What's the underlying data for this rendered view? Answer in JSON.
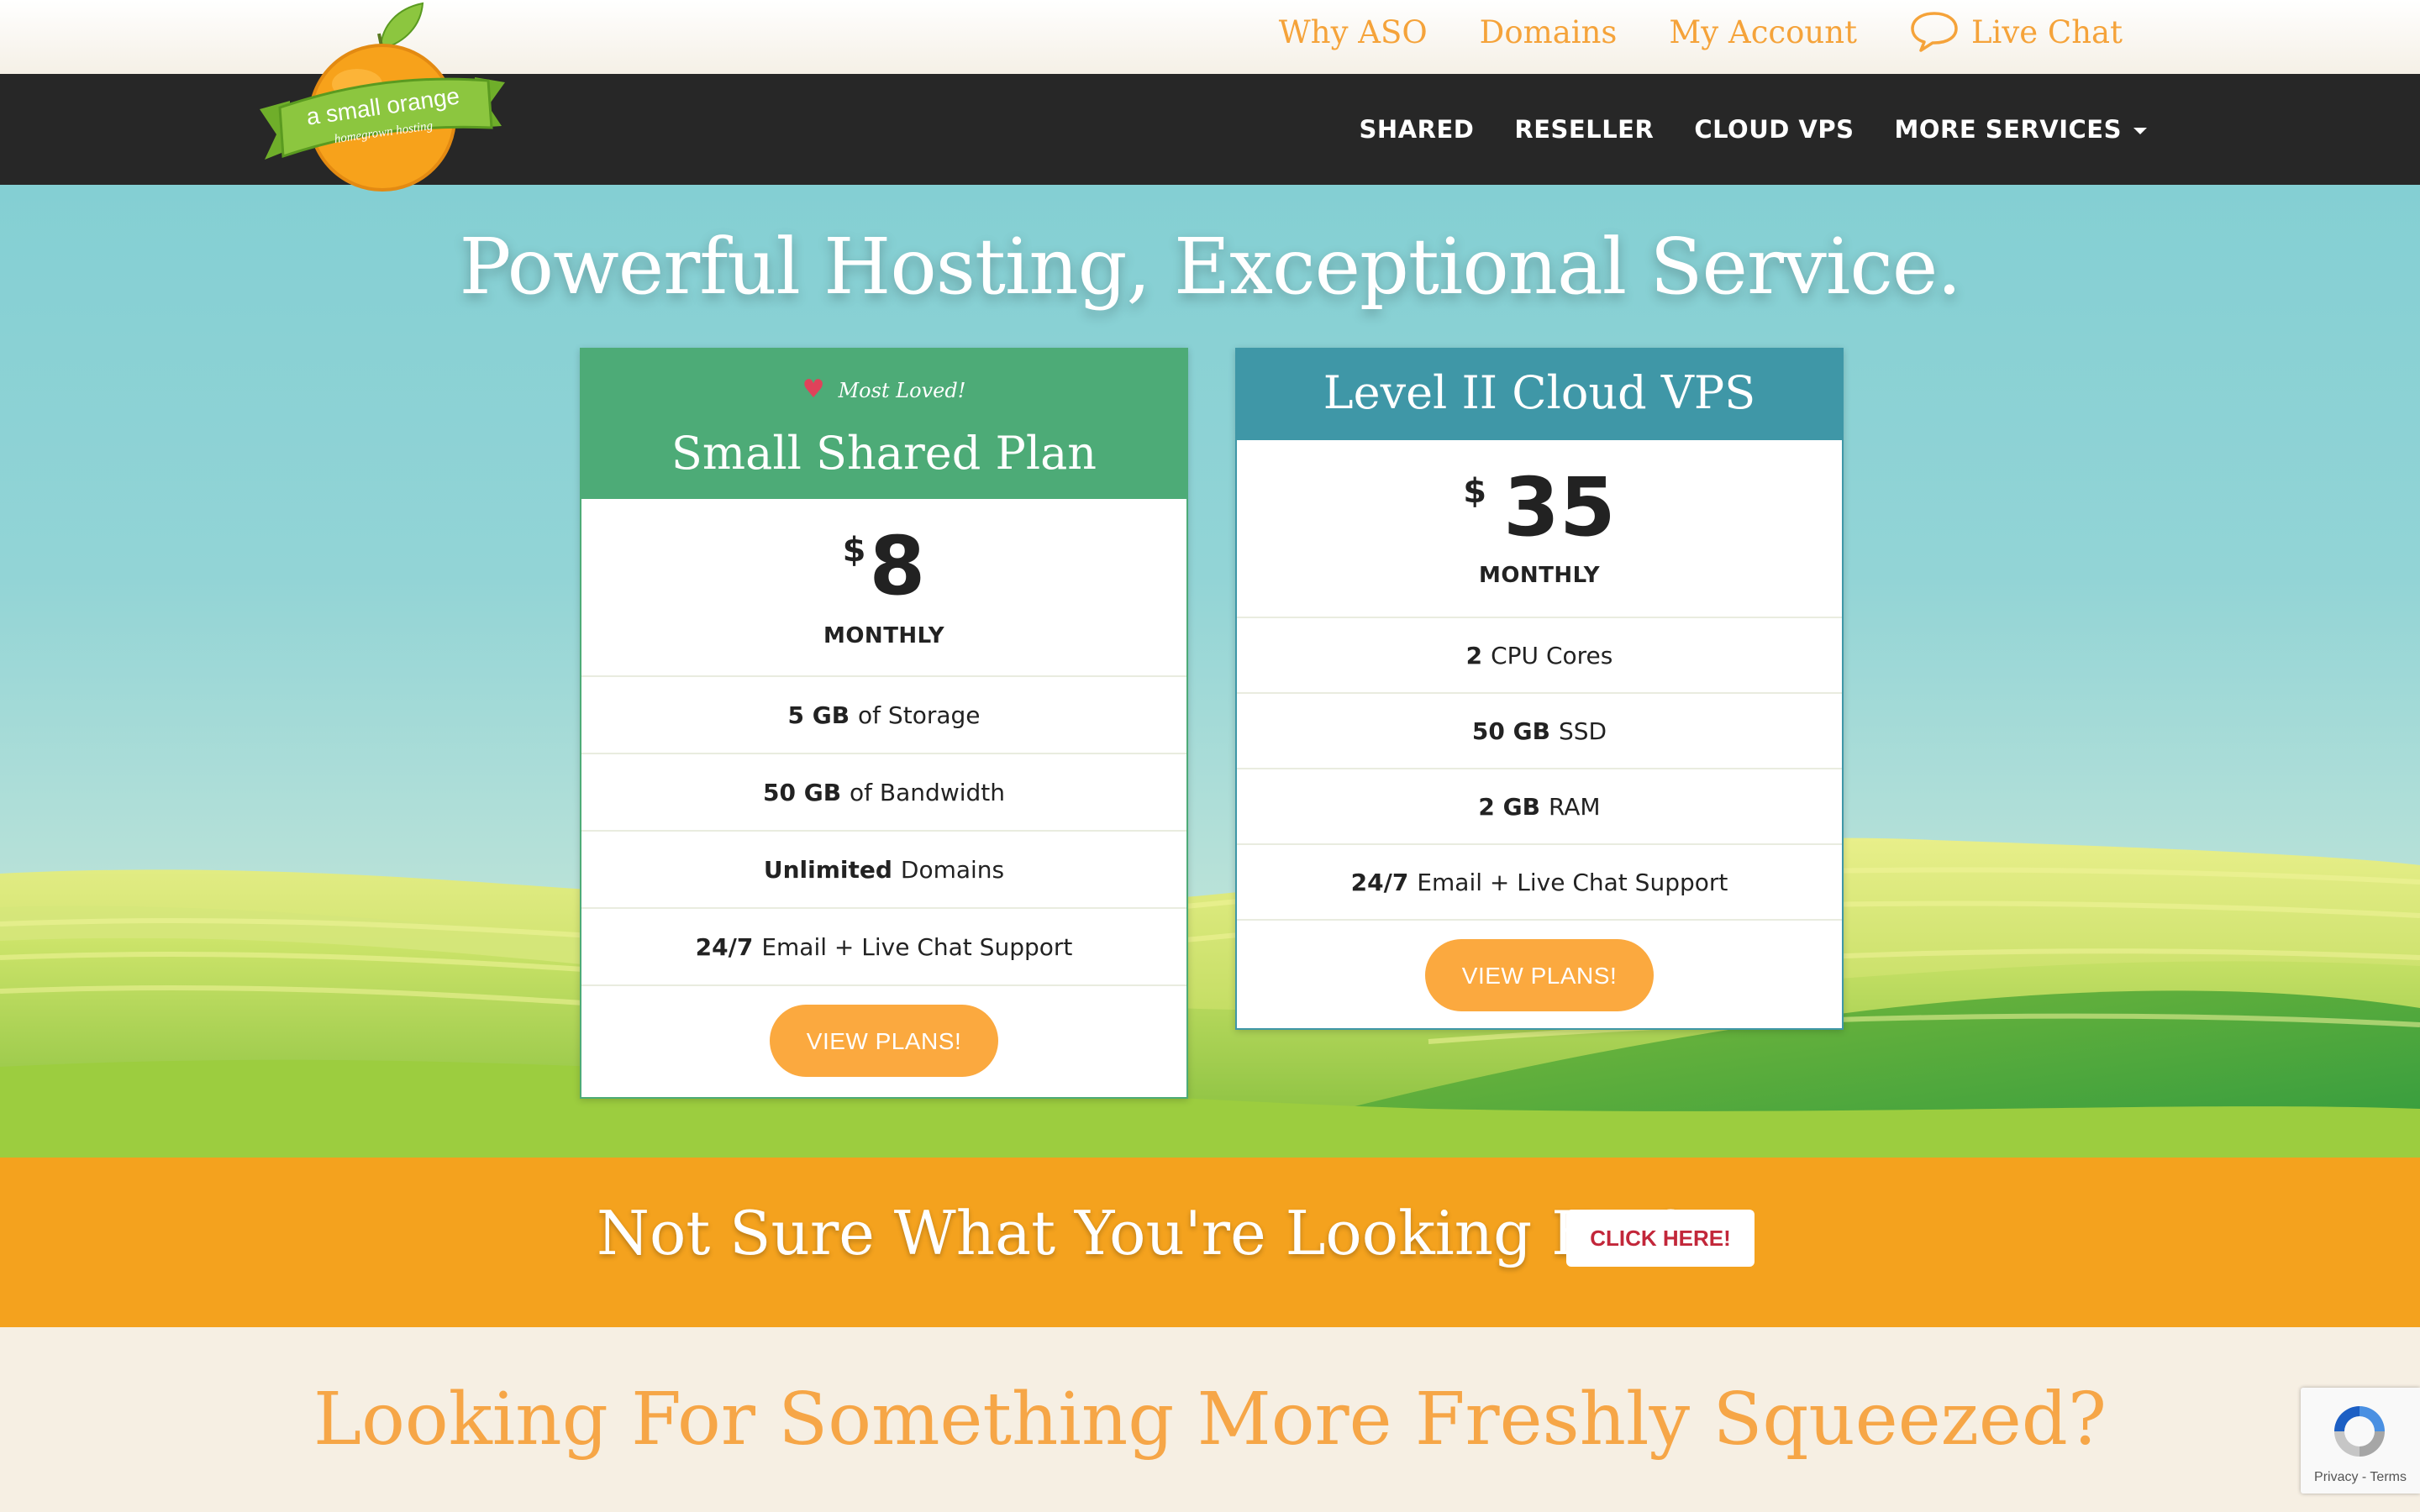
{
  "topbar": {
    "links": [
      "Why ASO",
      "Domains",
      "My Account"
    ],
    "live_chat": "Live Chat"
  },
  "logo": {
    "line1": "a small orange",
    "line2": "homegrown hosting"
  },
  "nav": {
    "items": [
      "SHARED",
      "RESELLER",
      "CLOUD VPS",
      "MORE SERVICES"
    ]
  },
  "hero": {
    "title": "Powerful Hosting, Exceptional Service."
  },
  "plans": [
    {
      "badge": "Most Loved!",
      "name": "Small Shared Plan",
      "currency": "$",
      "price": "8",
      "period": "MONTHLY",
      "features": [
        {
          "bold": "5 GB",
          "text": "of Storage"
        },
        {
          "bold": "50 GB",
          "text": "of Bandwidth"
        },
        {
          "bold": "Unlimited",
          "text": "Domains"
        },
        {
          "bold": "24/7",
          "text": "Email + Live Chat Support"
        }
      ],
      "button": "VIEW PLANS!",
      "color": "#4dab77"
    },
    {
      "name": "Level II Cloud VPS",
      "currency": "$",
      "price": "35",
      "period": "MONTHLY",
      "features": [
        {
          "bold": "2",
          "text": "CPU Cores"
        },
        {
          "bold": "50 GB",
          "text": "SSD"
        },
        {
          "bold": "2 GB",
          "text": "RAM"
        },
        {
          "bold": "24/7",
          "text": "Email + Live Chat Support"
        }
      ],
      "button": "VIEW PLANS!",
      "color": "#3f97a7"
    }
  ],
  "band": {
    "text": "Not Sure What You're Looking For?",
    "button": "CLICK HERE!"
  },
  "bottom": {
    "title": "Looking For Something More Freshly Squeezed?"
  },
  "recaptcha": {
    "text": "Privacy - Terms"
  },
  "colors": {
    "accent_orange": "#f4a21e",
    "button_orange": "#fba93f",
    "shared_green": "#4dab77",
    "vps_teal": "#3f97a7",
    "nav_dark": "#272727"
  }
}
